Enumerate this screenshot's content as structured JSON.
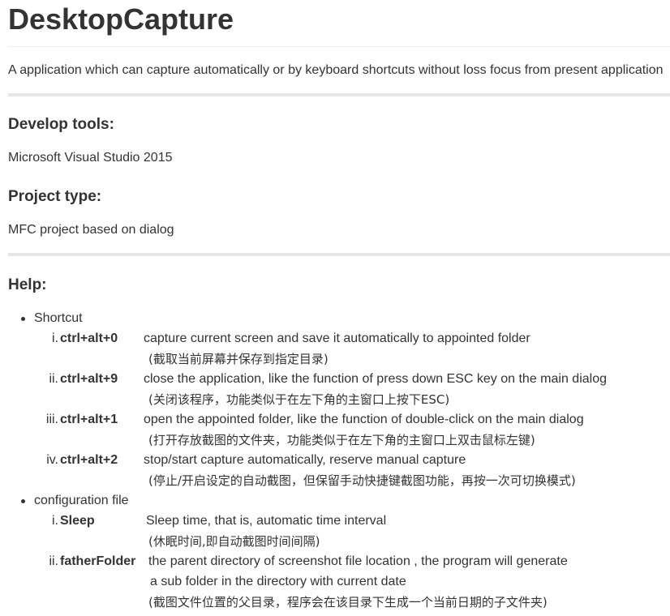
{
  "title": "DesktopCapture",
  "description": "A application which can capture automatically or by keyboard shortcuts without loss focus from present application",
  "develop_tools": {
    "heading": "Develop tools:",
    "value": "Microsoft Visual Studio 2015"
  },
  "project_type": {
    "heading": "Project type:",
    "value": "MFC project based on dialog"
  },
  "help": {
    "heading": "Help:",
    "sections": [
      {
        "label": "Shortcut",
        "items": [
          {
            "numeral": "i.",
            "key": "ctrl+alt+0",
            "desc": "capture current screen and save it automatically to appointed folder",
            "cn": "(截取当前屏幕并保存到指定目录)"
          },
          {
            "numeral": "ii.",
            "key": "ctrl+alt+9",
            "desc": "close the application, like the function of press down ESC key on the main dialog",
            "cn": "(关闭该程序，功能类似于在左下角的主窗口上按下ESC)"
          },
          {
            "numeral": "iii.",
            "key": "ctrl+alt+1",
            "desc": "open the appointed folder, like the function of double-click on the main dialog",
            "cn": "(打开存放截图的文件夹，功能类似于在左下角的主窗口上双击鼠标左键)"
          },
          {
            "numeral": "iv.",
            "key": "ctrl+alt+2",
            "desc": "stop/start capture automatically, reserve manual capture",
            "cn": "(停止/开启设定的自动截图，但保留手动快捷键截图功能，再按一次可切换模式)"
          }
        ]
      },
      {
        "label": "configuration file",
        "items": [
          {
            "numeral": "i.",
            "key": "Sleep",
            "desc": "Sleep time, that is, automatic time interval",
            "cn": "(休眠时间,即自动截图时间间隔)"
          },
          {
            "numeral": "ii.",
            "key": "fatherFolder",
            "desc": "the parent directory of screenshot file location , the program will generate",
            "desc_line2": "a sub folder in the directory with current date",
            "cn": "(截图文件位置的父目录，程序会在该目录下生成一个当前日期的子文件夹)"
          }
        ]
      }
    ]
  }
}
